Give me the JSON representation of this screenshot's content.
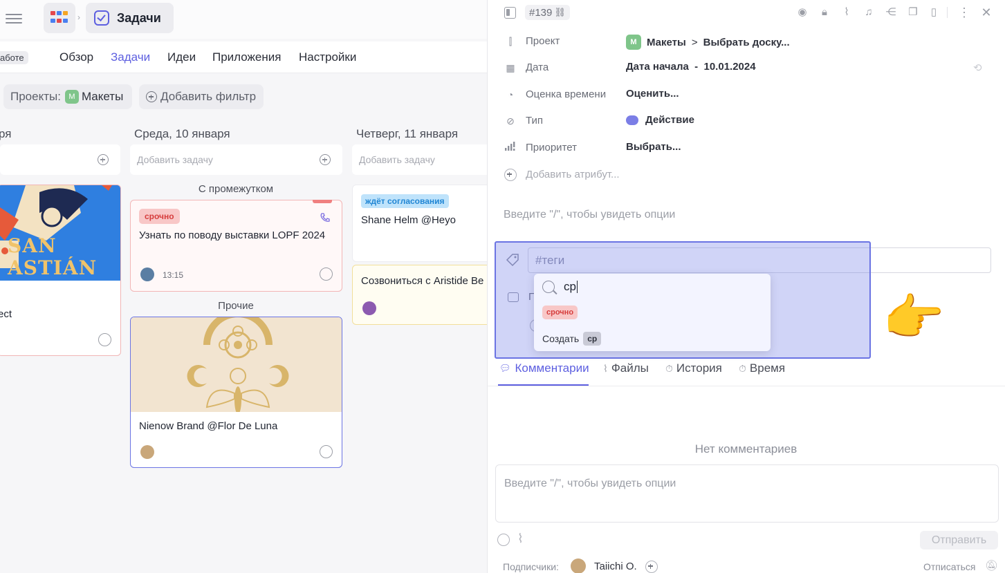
{
  "app": {
    "title": "Задачи",
    "work_badge": "аботе"
  },
  "nav": {
    "tabs": [
      {
        "label": "Обзор",
        "active": false
      },
      {
        "label": "Задачи",
        "active": true
      },
      {
        "label": "Идеи",
        "active": false
      },
      {
        "label": "Приложения",
        "active": false
      },
      {
        "label": "Настройки",
        "active": false
      }
    ]
  },
  "filters": {
    "projects_label": "Проекты:",
    "project_badge": "М",
    "project_name": "Макеты",
    "add_filter": "Добавить фильтр"
  },
  "board": {
    "columns": [
      {
        "title": "ря",
        "add_placeholder": ""
      },
      {
        "title": "Среда, 10 января",
        "add_placeholder": "Добавить задачу"
      },
      {
        "title": "Четверг, 11 января",
        "add_placeholder": "Добавить задачу"
      }
    ],
    "col0_card": {
      "image_text": "SAN ASTIÁN",
      "title": "ect"
    },
    "group_interval": "С промежутком",
    "group_other": "Прочие",
    "card_lopf": {
      "tag": "срочно",
      "title": "Узнать по поводу выставки LOPF 2024",
      "time": "13:15"
    },
    "card_flor": {
      "title": "Nienow Brand @Flor De Luna"
    },
    "card_shane": {
      "tag": "ждёт согласования",
      "title": "Shane Helm @Heyo"
    },
    "card_aristide": {
      "title": "Созвониться с Aristide Be"
    }
  },
  "panel": {
    "task_id": "#139",
    "attributes": {
      "project_label": "Проект",
      "project_badge": "М",
      "project_name": "Макеты",
      "project_sep": ">",
      "project_sub": "Выбрать доску...",
      "date_label": "Дата",
      "date_value": "Дата начала  -  10.01.2024",
      "estimate_label": "Оценка времени",
      "estimate_value": "Оценить...",
      "type_label": "Тип",
      "type_value": "Действие",
      "priority_label": "Приоритет",
      "priority_value": "Выбрать...",
      "add_attr": "Добавить атрибут..."
    },
    "slash_hint": "Введите \"/\", чтобы увидеть опции",
    "tags_placeholder": "#теги",
    "hidden_row_letter": "П",
    "dropdown": {
      "search_value": "ср",
      "option_tag": "срочно",
      "create_label": "Создать",
      "create_value": "ср"
    },
    "tabs": [
      {
        "label": "Комментарии",
        "active": true
      },
      {
        "label": "Файлы",
        "active": false
      },
      {
        "label": "История",
        "active": false
      },
      {
        "label": "Время",
        "active": false
      }
    ],
    "no_comments": "Нет комментариев",
    "comment_placeholder": "Введите \"/\", чтобы увидеть опции",
    "send_label": "Отправить",
    "subscribers_label": "Подписчики:",
    "subscriber_name": "Taiichi O.",
    "unsubscribe_label": "Отписаться"
  },
  "colors": {
    "accent": "#5d5fe0",
    "overlay": "#6a73e3",
    "urgent_bg": "#f8c7c7",
    "urgent_text": "#d63c3c",
    "waiting_bg": "#bfe3fb",
    "waiting_text": "#2186d4"
  },
  "pointer": "👉"
}
